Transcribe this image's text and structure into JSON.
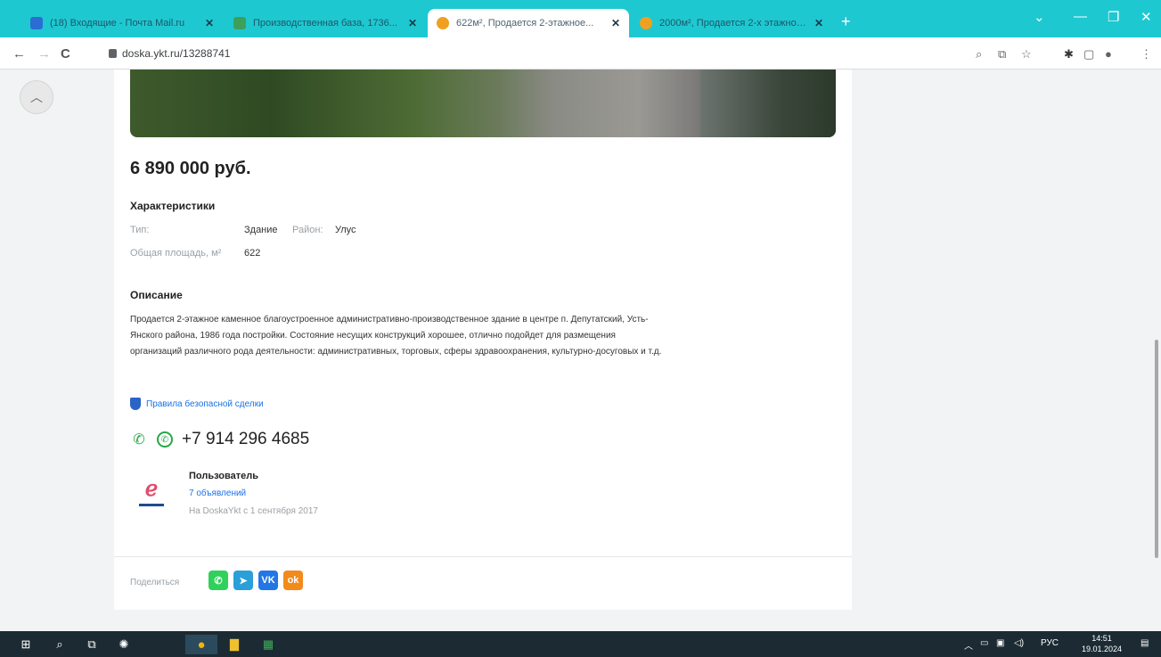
{
  "browser": {
    "tabs": [
      {
        "title": "(18) Входящие - Почта Mail.ru",
        "active": false,
        "favicon_color": "#2a6ed3"
      },
      {
        "title": "Производственная база, 1736...",
        "active": false,
        "favicon_color": "#3ca05a"
      },
      {
        "title": "622м², Продается 2-этажное...",
        "active": true,
        "favicon_color": "#f0a020"
      },
      {
        "title": "2000м², Продается 2-х этажное...",
        "active": false,
        "favicon_color": "#f0a020"
      }
    ],
    "new_tab": "+",
    "url": "doska.ykt.ru/13288741",
    "back": "←",
    "forward": "→",
    "reload": "C"
  },
  "listing": {
    "price": "6 890 000 руб.",
    "characteristics_heading": "Характеристики",
    "type_label": "Тип:",
    "type_value": "Здание",
    "district_label": "Район:",
    "district_value": "Улус",
    "area_label": "Общая площадь, м²",
    "area_value": "622",
    "description_heading": "Описание",
    "description": "Продается 2-этажное каменное благоустроенное административно-производственное здание в центре п. Депутатский, Усть-Янского района, 1986 года постройки. Состояние несущих конструкций хорошее, отлично подойдет для размещения организаций различного рода деятельности: административных, торговых, сферы здравоохранения, культурно-досуговых и т.д.",
    "safe_deal_link": "Правила безопасной сделки",
    "phone": "+7 914 296 4685",
    "seller": {
      "name": "Пользователь",
      "ads": "7 объявлений",
      "since": "На DoskaYkt с 1 сентября 2017"
    },
    "share_label": "Поделиться",
    "share": [
      {
        "name": "whatsapp",
        "glyph": "✆",
        "color": "#2fd15a"
      },
      {
        "name": "telegram",
        "glyph": "➤",
        "color": "#2a9fd8"
      },
      {
        "name": "vk",
        "glyph": "VK",
        "color": "#2376e5"
      },
      {
        "name": "odnoklassniki",
        "glyph": "ok",
        "color": "#f28a1c"
      }
    ]
  },
  "taskbar": {
    "lang": "РУС",
    "time": "14:51",
    "date": "19.01.2024"
  }
}
